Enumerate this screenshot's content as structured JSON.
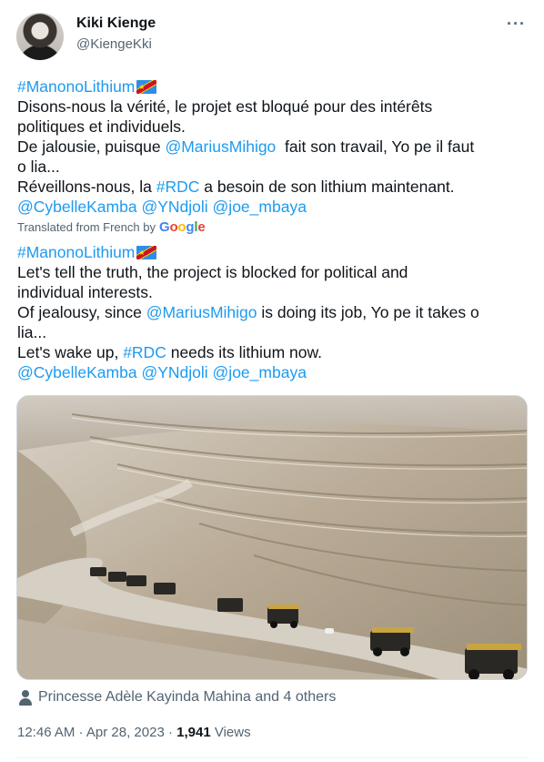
{
  "author": {
    "name": "Kiki Kienge",
    "handle": "@KiengeKki"
  },
  "more_label": "···",
  "original": {
    "hashtag": "#ManonoLithium",
    "line1": "Disons-nous la vérité, le projet est bloqué pour des intérêts",
    "line2": "politiques et individuels.",
    "line3_pre": "De jalousie, puisque ",
    "line3_mention": "@MariusMihigo",
    "line3_post": "  fait son travail, Yo pe il faut",
    "line4": "o lia...",
    "line5_pre": "Réveillons-nous, la ",
    "line5_tag": "#RDC",
    "line5_post": " a besoin de son lithium maintenant.",
    "mentions": [
      "@CybelleKamba",
      "@YNdjoli",
      "@joe_mbaya"
    ]
  },
  "translation": {
    "label": "Translated from French by",
    "provider": "Google"
  },
  "translated": {
    "hashtag": "#ManonoLithium",
    "line1": "Let's tell the truth, the project is blocked for political and",
    "line2": "individual interests.",
    "line3_pre": "Of jealousy, since ",
    "line3_mention": "@MariusMihigo",
    "line3_post": " is doing its job, Yo pe it takes o",
    "line4": "lia...",
    "line5_pre": "Let's wake up, ",
    "line5_tag": "#RDC",
    "line5_post": " needs its lithium now.",
    "mentions": [
      "@CybelleKamba",
      "@YNdjoli",
      "@joe_mbaya"
    ]
  },
  "likes": {
    "text": "Princesse Adèle Kayinda Mahina and 4 others"
  },
  "meta": {
    "time": "12:46 AM",
    "sep": " · ",
    "date": "Apr 28, 2023",
    "views_count": "1,941",
    "views_label": " Views"
  },
  "colors": {
    "link": "#1d9bf0",
    "secondary": "#536471",
    "text": "#0f1419"
  }
}
